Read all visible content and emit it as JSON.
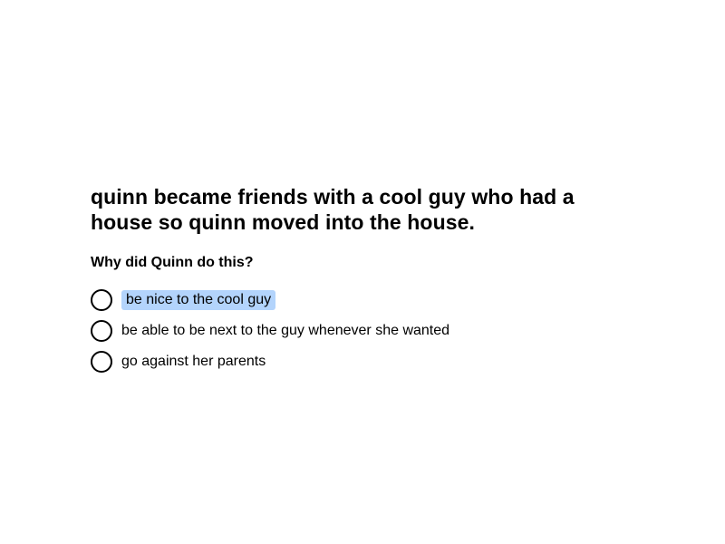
{
  "question": {
    "passage": "quinn became friends with a cool guy who had a house so quinn moved into the house.",
    "prompt": "Why did Quinn do this?",
    "options": [
      {
        "label": "be nice to the cool guy",
        "highlighted": true
      },
      {
        "label": "be able to be next to the guy whenever she wanted",
        "highlighted": false
      },
      {
        "label": "go against her parents",
        "highlighted": false
      }
    ]
  },
  "colors": {
    "highlight": "#b3d4fc",
    "text": "#000000",
    "background": "#ffffff"
  }
}
